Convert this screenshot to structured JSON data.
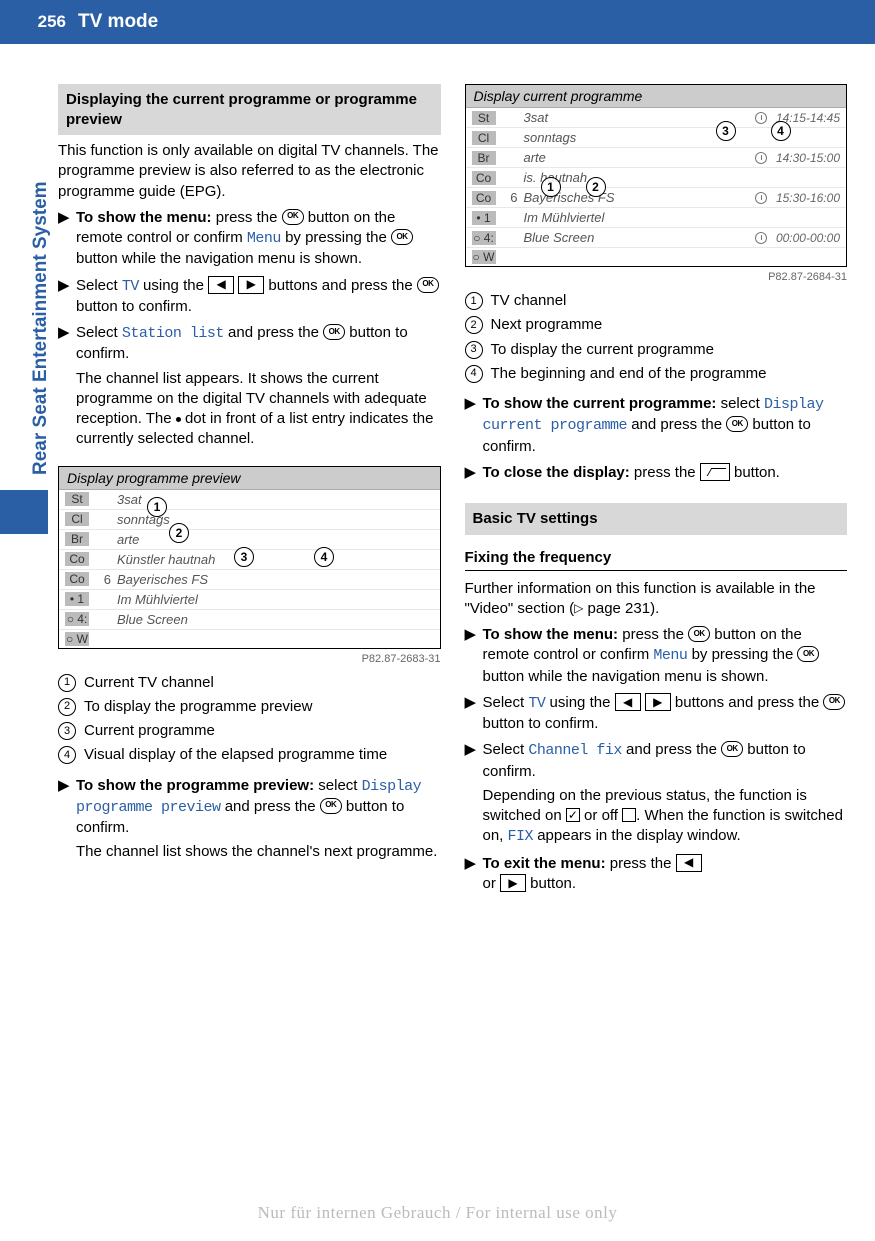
{
  "page_number": "256",
  "page_title": "TV mode",
  "sidebar_label": "Rear Seat Entertainment System",
  "footer_watermark": "Nur für internen Gebrauch / For internal use only",
  "sec1_head": "Displaying the current programme or programme preview",
  "sec1_para": "This function is only available on digital TV channels. The programme preview is also referred to as the electronic programme guide (EPG).",
  "sec1_step1_a": "To show the menu:",
  "sec1_step1_b": " press the ",
  "sec1_step1_c": " button on the remote control or confirm ",
  "sec1_step1_menu": "Menu",
  "sec1_step1_d": " by pressing the ",
  "sec1_step1_e": " button while the navigation menu is shown.",
  "sec1_step2_a": "Select ",
  "sec1_step2_tv": "TV",
  "sec1_step2_b": " using the ",
  "sec1_step2_c": " buttons and press the ",
  "sec1_step2_d": " button to confirm.",
  "sec1_step3_a": "Select ",
  "sec1_step3_station": "Station list",
  "sec1_step3_b": " and press the ",
  "sec1_step3_c": " button to confirm.",
  "sec1_step3_para": "The channel list appears. It shows the current programme on the digital TV channels with adequate reception. The ",
  "sec1_step3_para2": " dot in front of a list entry indicates the currently selected channel.",
  "fig1_title": "Display programme preview",
  "fig1_rows": [
    {
      "side": "St",
      "num": "",
      "name": "3sat",
      "time": ""
    },
    {
      "side": "Cl",
      "num": "",
      "name": "sonntags",
      "time": ""
    },
    {
      "side": "Br",
      "num": "",
      "name": "arte",
      "time": ""
    },
    {
      "side": "Co",
      "num": "",
      "name": "Künstler hautnah",
      "time": ""
    },
    {
      "side": "Co",
      "num": "6",
      "name": "Bayerisches FS",
      "time": ""
    },
    {
      "side": "• 1",
      "num": "",
      "name": "Im Mühlviertel",
      "time": ""
    },
    {
      "side": "○ 4:",
      "num": "",
      "name": "Blue Screen",
      "time": ""
    },
    {
      "side": "○ W",
      "num": "",
      "name": "",
      "time": ""
    }
  ],
  "fig1_id": "P82.87-2683-31",
  "leg1_1": "Current TV channel",
  "leg1_2": "To display the programme preview",
  "leg1_3": "Current programme",
  "leg1_4": "Visual display of the elapsed programme time",
  "sec1_step4_a": "To show the programme preview:",
  "sec1_step4_b": " select ",
  "sec1_step4_disp": "Display programme preview",
  "sec1_step4_c": " and press the ",
  "sec1_step4_d": " button to confirm.",
  "sec1_step4_para": "The channel list shows the channel's next programme.",
  "fig2_title": "Display current programme",
  "fig2_rows": [
    {
      "side": "St",
      "num": "",
      "name": "3sat",
      "time": "14:15-14:45"
    },
    {
      "side": "Cl",
      "num": "",
      "name": "sonntags",
      "time": ""
    },
    {
      "side": "Br",
      "num": "",
      "name": "arte",
      "time": "14:30-15:00"
    },
    {
      "side": "Co",
      "num": "",
      "name": "is. hautnah",
      "time": ""
    },
    {
      "side": "Co",
      "num": "6",
      "name": "Bayerisches FS",
      "time": "15:30-16:00"
    },
    {
      "side": "• 1",
      "num": "",
      "name": "Im Mühlviertel",
      "time": ""
    },
    {
      "side": "○ 4:",
      "num": "",
      "name": "Blue Screen",
      "time": "00:00-00:00"
    },
    {
      "side": "○ W",
      "num": "",
      "name": "",
      "time": ""
    }
  ],
  "fig2_id": "P82.87-2684-31",
  "leg2_1": "TV channel",
  "leg2_2": "Next programme",
  "leg2_3": "To display the current programme",
  "leg2_4": "The beginning and end of the programme",
  "sec2_step1_a": "To show the current programme:",
  "sec2_step1_b": " select ",
  "sec2_step1_disp": "Display current programme",
  "sec2_step1_c": " and press the ",
  "sec2_step1_d": " button to confirm.",
  "sec2_step2_a": "To close the display:",
  "sec2_step2_b": " press the ",
  "sec2_step2_c": " button.",
  "sec3_head": "Basic TV settings",
  "sec3_sub": "Fixing the frequency",
  "sec3_para_a": "Further information on this function is available in the \"Video\" section (",
  "sec3_para_b": " page 231).",
  "sec3_step1_a": "To show the menu:",
  "sec3_step1_b": " press the ",
  "sec3_step1_c": " button on the remote control or confirm ",
  "sec3_step1_menu": "Menu",
  "sec3_step1_d": " by pressing the ",
  "sec3_step1_e": " button while the navigation menu is shown.",
  "sec3_step2_a": "Select ",
  "sec3_step2_tv": "TV",
  "sec3_step2_b": " using the ",
  "sec3_step2_c": " buttons and press the ",
  "sec3_step2_d": " button to confirm.",
  "sec3_step3_a": "Select ",
  "sec3_step3_cf": "Channel fix",
  "sec3_step3_b": " and press the ",
  "sec3_step3_c": " button to confirm.",
  "sec3_step3_para_a": "Depending on the previous status, the function is switched on ",
  "sec3_step3_para_b": " or off ",
  "sec3_step3_para_c": ". When the function is switched on, ",
  "sec3_step3_fix": "FIX",
  "sec3_step3_para_d": " appears in the display window.",
  "sec3_step4_a": "To exit the menu:",
  "sec3_step4_b": " press the ",
  "sec3_step4_c": "or ",
  "sec3_step4_d": " button."
}
